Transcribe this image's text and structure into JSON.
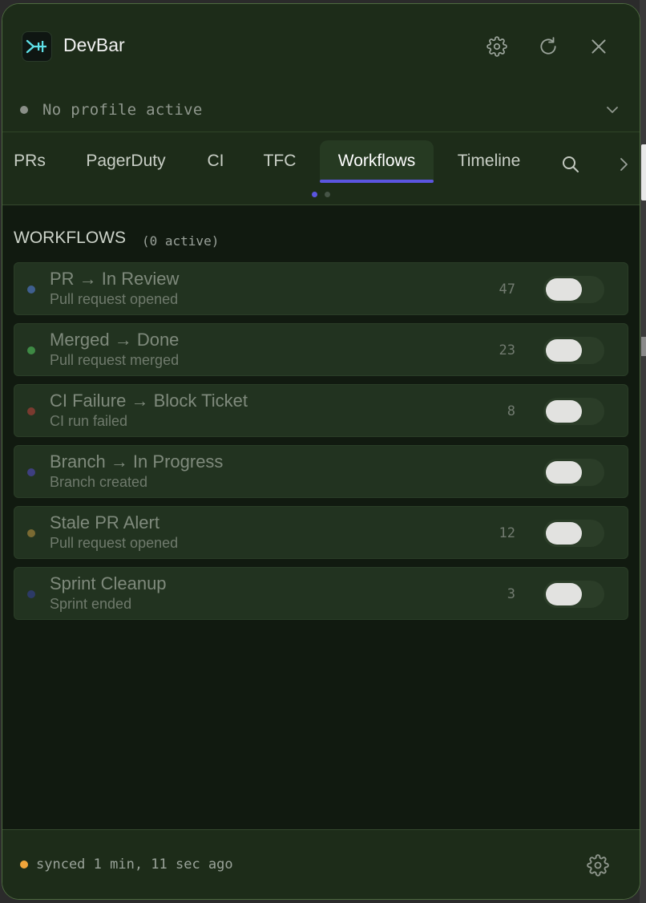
{
  "app": {
    "title": "DevBar"
  },
  "header": {
    "settings_icon": "gear-icon",
    "refresh_icon": "refresh-icon",
    "close_icon": "close-icon"
  },
  "profile": {
    "status_text": "No profile active"
  },
  "tabs": [
    {
      "label": "PRs",
      "active": false
    },
    {
      "label": "PagerDuty",
      "active": false
    },
    {
      "label": "CI",
      "active": false
    },
    {
      "label": "TFC",
      "active": false
    },
    {
      "label": "Workflows",
      "active": true
    },
    {
      "label": "Timeline",
      "active": false
    }
  ],
  "section": {
    "title": "WORKFLOWS",
    "count_text": "(0 active)"
  },
  "workflows": [
    {
      "title": "PR → In Review",
      "subtitle": "Pull request opened",
      "count": "47",
      "color": "#3f5f8f",
      "enabled": false
    },
    {
      "title": "Merged → Done",
      "subtitle": "Pull request merged",
      "count": "23",
      "color": "#3e8a44",
      "enabled": false
    },
    {
      "title": "CI Failure → Block Ticket",
      "subtitle": "CI run failed",
      "count": "8",
      "color": "#7a3a2f",
      "enabled": false
    },
    {
      "title": "Branch → In Progress",
      "subtitle": "Branch created",
      "count": "",
      "color": "#3e3f80",
      "enabled": false
    },
    {
      "title": "Stale PR Alert",
      "subtitle": "Pull request opened",
      "count": "12",
      "color": "#7a6a32",
      "enabled": false
    },
    {
      "title": "Sprint Cleanup",
      "subtitle": "Sprint ended",
      "count": "3",
      "color": "#2c3a66",
      "enabled": false
    }
  ],
  "footer": {
    "sync_text": "synced 1 min, 11 sec ago"
  },
  "colors": {
    "accent": "#5b55e0",
    "sync_status": "#f0a53a"
  }
}
